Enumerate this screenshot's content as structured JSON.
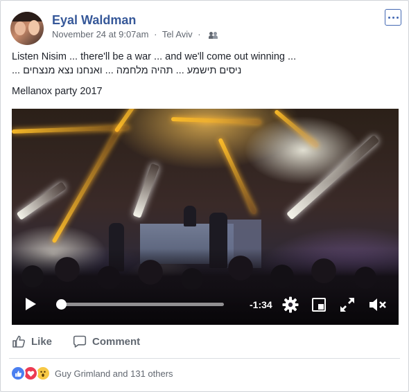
{
  "post": {
    "author": "Eyal Waldman",
    "date": "November 24 at 9:07am",
    "location": "Tel Aviv",
    "meta_separator": "·",
    "more_icon": "more-options-icon",
    "audience_icon": "friends-icon",
    "text_lines": [
      "Listen Nisim ... there'll be a war ... and we'll come out winning ...",
      "ניסים תישמע ... תהיה מלחמה ... ואנחנו נצא מנצחים ...",
      "Mellanox party 2017"
    ]
  },
  "video": {
    "time_remaining": "-1:34",
    "progress_fraction": 0.02,
    "controls": {
      "play_icon": "play-icon",
      "settings_icon": "gear-icon",
      "fullsize_icon": "fullsize-icon",
      "expand_icon": "expand-icon",
      "mute_icon": "mute-icon"
    }
  },
  "actions": {
    "like_label": "Like",
    "comment_label": "Comment"
  },
  "reactions": {
    "icons": [
      "like-reaction-icon",
      "love-reaction-icon",
      "wow-reaction-icon"
    ],
    "summary": "Guy Grimland and 131 others"
  },
  "colors": {
    "author_link": "#365899",
    "secondary_text": "#616770",
    "accent": "#4267b2"
  }
}
